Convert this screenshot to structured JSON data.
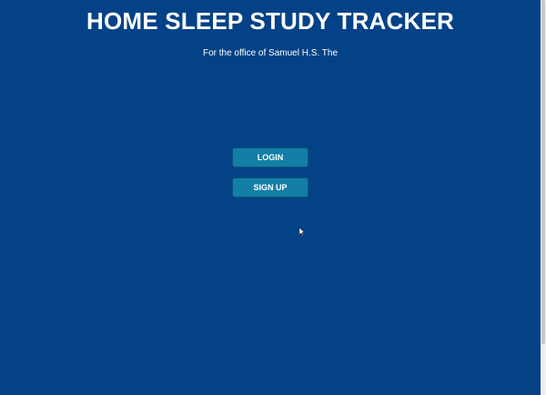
{
  "header": {
    "title": "HOME SLEEP STUDY TRACKER",
    "subtitle": "For the office of Samuel H.S. The"
  },
  "actions": {
    "login_label": "LOGIN",
    "signup_label": "SIGN UP"
  },
  "colors": {
    "background": "#034287",
    "button": "#137fa6",
    "text": "#ffffff"
  },
  "icons": {
    "cursor": "mouse-pointer-icon"
  }
}
